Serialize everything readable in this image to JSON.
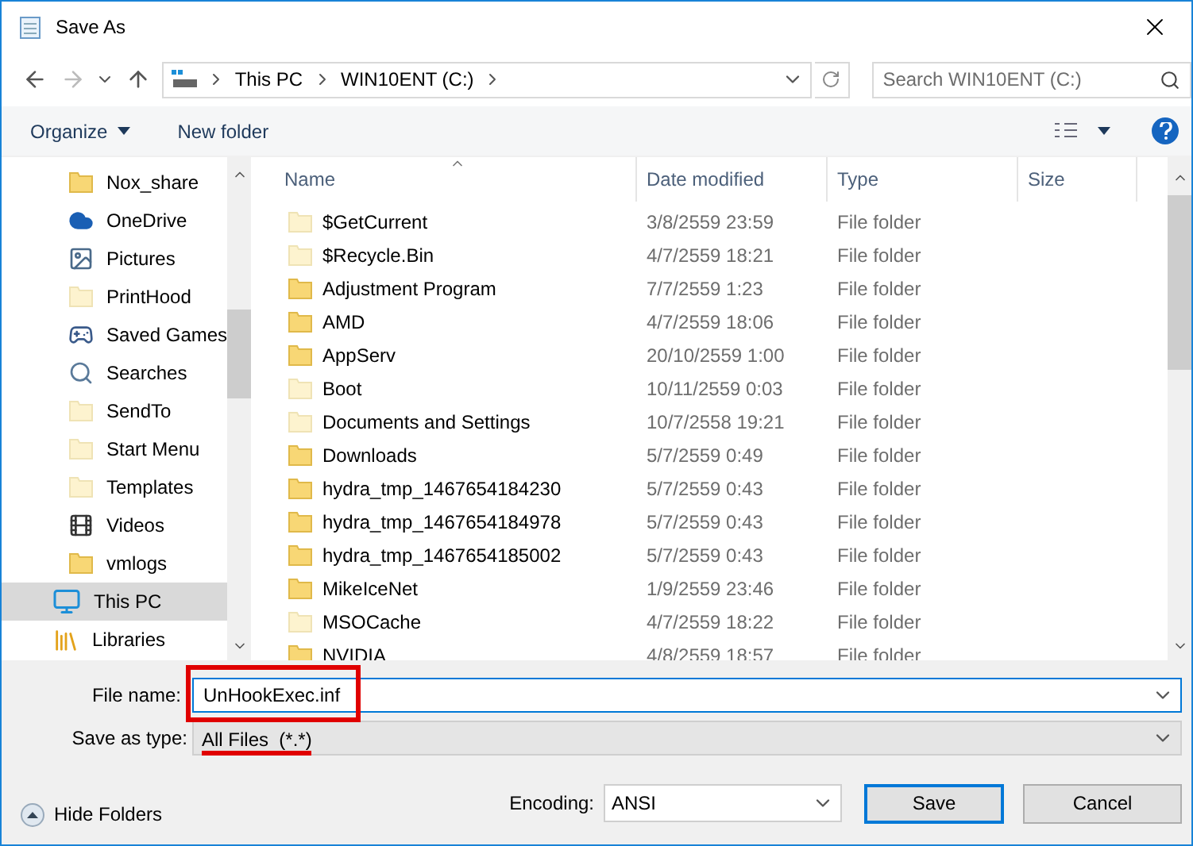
{
  "window": {
    "title": "Save As"
  },
  "address": {
    "crumbs": [
      "This PC",
      "WIN10ENT (C:)"
    ]
  },
  "search": {
    "placeholder": "Search WIN10ENT (C:)"
  },
  "toolbar": {
    "organize": "Organize",
    "new_folder": "New folder"
  },
  "sidebar": {
    "items": [
      {
        "label": "Nox_share",
        "kind": "folder",
        "hidden": false,
        "selected": false
      },
      {
        "label": "OneDrive",
        "kind": "cloud",
        "hidden": false,
        "selected": false
      },
      {
        "label": "Pictures",
        "kind": "pictures",
        "hidden": false,
        "selected": false
      },
      {
        "label": "PrintHood",
        "kind": "folder",
        "hidden": true,
        "selected": false
      },
      {
        "label": "Saved Games",
        "kind": "games",
        "hidden": false,
        "selected": false
      },
      {
        "label": "Searches",
        "kind": "search",
        "hidden": false,
        "selected": false
      },
      {
        "label": "SendTo",
        "kind": "folder",
        "hidden": true,
        "selected": false
      },
      {
        "label": "Start Menu",
        "kind": "folder",
        "hidden": true,
        "selected": false
      },
      {
        "label": "Templates",
        "kind": "folder",
        "hidden": true,
        "selected": false
      },
      {
        "label": "Videos",
        "kind": "videos",
        "hidden": false,
        "selected": false
      },
      {
        "label": "vmlogs",
        "kind": "folder",
        "hidden": false,
        "selected": false
      },
      {
        "label": "This PC",
        "kind": "pc",
        "hidden": false,
        "selected": true
      },
      {
        "label": "Libraries",
        "kind": "library",
        "hidden": false,
        "selected": false
      }
    ]
  },
  "table": {
    "columns": [
      "Name",
      "Date modified",
      "Type",
      "Size"
    ],
    "rows": [
      {
        "name": "$GetCurrent",
        "date": "3/8/2559 23:59",
        "type": "File folder",
        "hidden": true
      },
      {
        "name": "$Recycle.Bin",
        "date": "4/7/2559 18:21",
        "type": "File folder",
        "hidden": true
      },
      {
        "name": "Adjustment Program",
        "date": "7/7/2559 1:23",
        "type": "File folder",
        "hidden": false
      },
      {
        "name": "AMD",
        "date": "4/7/2559 18:06",
        "type": "File folder",
        "hidden": false
      },
      {
        "name": "AppServ",
        "date": "20/10/2559 1:00",
        "type": "File folder",
        "hidden": false
      },
      {
        "name": "Boot",
        "date": "10/11/2559 0:03",
        "type": "File folder",
        "hidden": true
      },
      {
        "name": "Documents and Settings",
        "date": "10/7/2558 19:21",
        "type": "File folder",
        "hidden": true
      },
      {
        "name": "Downloads",
        "date": "5/7/2559 0:49",
        "type": "File folder",
        "hidden": false
      },
      {
        "name": "hydra_tmp_1467654184230",
        "date": "5/7/2559 0:43",
        "type": "File folder",
        "hidden": false
      },
      {
        "name": "hydra_tmp_1467654184978",
        "date": "5/7/2559 0:43",
        "type": "File folder",
        "hidden": false
      },
      {
        "name": "hydra_tmp_1467654185002",
        "date": "5/7/2559 0:43",
        "type": "File folder",
        "hidden": false
      },
      {
        "name": "MikeIceNet",
        "date": "1/9/2559 23:46",
        "type": "File folder",
        "hidden": false
      },
      {
        "name": "MSOCache",
        "date": "4/7/2559 18:22",
        "type": "File folder",
        "hidden": true
      },
      {
        "name": "NVIDIA",
        "date": "4/8/2559 18:57",
        "type": "File folder",
        "hidden": false
      }
    ]
  },
  "file_name": {
    "label": "File name:",
    "value": "UnHookExec.inf",
    "highlighted": true
  },
  "save_as_type": {
    "label": "Save as type:",
    "value": "All Files  (*.*)",
    "underlined": true
  },
  "hide_folders": "Hide Folders",
  "encoding": {
    "label": "Encoding:",
    "value": "ANSI"
  },
  "buttons": [
    "Save",
    "Cancel"
  ]
}
